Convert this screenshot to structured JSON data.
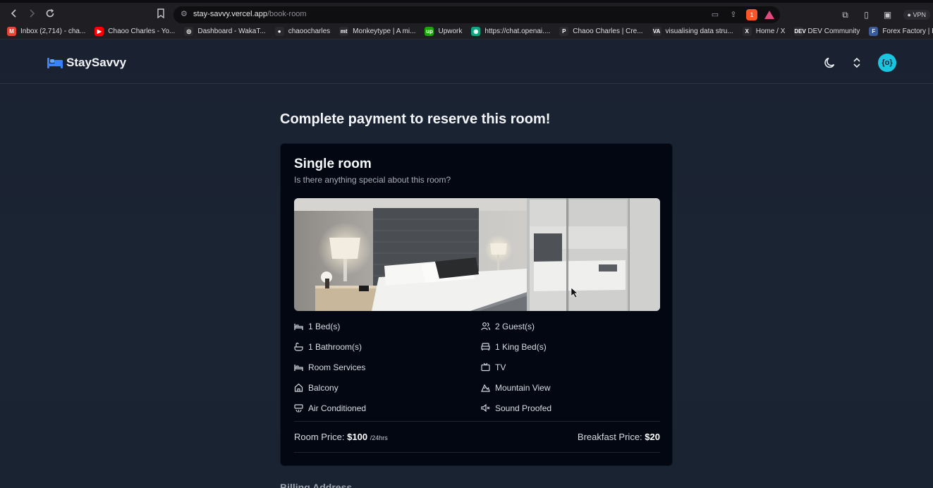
{
  "browser": {
    "url_host": "stay-savvy.vercel.app",
    "url_path": "/book-room",
    "brave_badge": "1",
    "vpn_label": "VPN",
    "bookmarks": [
      {
        "label": "Inbox (2,714) - cha...",
        "icon": "gmail-icon",
        "color": "#ea4335",
        "glyph": "M"
      },
      {
        "label": "Chaoo Charles - Yo...",
        "icon": "youtube-icon",
        "color": "#ff0000",
        "glyph": "▶"
      },
      {
        "label": "Dashboard - WakaT...",
        "icon": "wakatime-icon",
        "color": "#2a2a2e",
        "glyph": "◎"
      },
      {
        "label": "chaoocharles",
        "icon": "github-icon",
        "color": "#2a2a2e",
        "glyph": "●"
      },
      {
        "label": "Monkeytype | A mi...",
        "icon": "monkeytype-icon",
        "color": "#2a2a2e",
        "glyph": "mt"
      },
      {
        "label": "Upwork",
        "icon": "upwork-icon",
        "color": "#14a800",
        "glyph": "up"
      },
      {
        "label": "https://chat.openai....",
        "icon": "openai-icon",
        "color": "#10a37f",
        "glyph": "◉"
      },
      {
        "label": "Chaoo Charles | Cre...",
        "icon": "patreon-icon",
        "color": "#2a2a2e",
        "glyph": "P"
      },
      {
        "label": "visualising data stru...",
        "icon": "visualgo-icon",
        "color": "#2a2a2e",
        "glyph": "VA"
      },
      {
        "label": "Home / X",
        "icon": "x-icon",
        "color": "#2a2a2e",
        "glyph": "X"
      },
      {
        "label": "DEV Community",
        "icon": "dev-icon",
        "color": "#2a2a2e",
        "glyph": "DEV"
      },
      {
        "label": "Forex Factory | Fore...",
        "icon": "forexfactory-icon",
        "color": "#3a5a9a",
        "glyph": "F"
      }
    ]
  },
  "app": {
    "brand": "StaySavvy",
    "avatar_text": "{o}"
  },
  "page": {
    "title": "Complete payment to reserve this room!",
    "billing_heading": "Billing Address"
  },
  "room": {
    "title": "Single room",
    "description": "Is there anything special about this room?",
    "amenities": [
      {
        "label": "1 Bed(s)",
        "icon": "bed-icon"
      },
      {
        "label": "2 Guest(s)",
        "icon": "users-icon"
      },
      {
        "label": "1 Bathroom(s)",
        "icon": "bath-icon"
      },
      {
        "label": "1 King Bed(s)",
        "icon": "bed-double-icon"
      },
      {
        "label": "Room Services",
        "icon": "room-service-icon"
      },
      {
        "label": "TV",
        "icon": "tv-icon"
      },
      {
        "label": "Balcony",
        "icon": "home-icon"
      },
      {
        "label": "Mountain View",
        "icon": "mountain-icon"
      },
      {
        "label": "Air Conditioned",
        "icon": "air-vent-icon"
      },
      {
        "label": "Sound Proofed",
        "icon": "volume-x-icon"
      }
    ],
    "room_price_label": "Room Price:",
    "room_price_value": "$100",
    "room_price_unit": "/24hrs",
    "breakfast_price_label": "Breakfast Price:",
    "breakfast_price_value": "$20"
  }
}
